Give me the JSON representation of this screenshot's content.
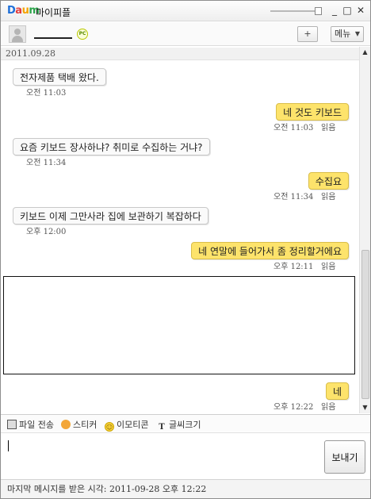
{
  "window": {
    "logo_text": "Daum",
    "title": "마이피플",
    "minimize_glyph": "_",
    "maximize_glyph": "□",
    "close_glyph": "✕"
  },
  "profile": {
    "status_badge": "PC",
    "add_user_glyph": "+",
    "menu_label": "메뉴",
    "menu_caret": "▼"
  },
  "chat": {
    "date": "2011.09.28",
    "messages": [
      {
        "text": "전자제품 택배 왔다.",
        "time": "오전 11:03",
        "read": ""
      },
      {
        "text": "네 것도 키보드",
        "time": "오전 11:03",
        "read": "읽음"
      },
      {
        "text": "요즘 키보드 장사하냐? 취미로 수집하는 거냐?",
        "time": "오전 11:34",
        "read": ""
      },
      {
        "text": "수집요",
        "time": "오전 11:34",
        "read": "읽음"
      },
      {
        "text": "키보드 이제 그만사라 집에 보관하기 복잡하다",
        "time": "오후 12:00",
        "read": ""
      },
      {
        "text": "네 연말에 들어가서 좀 정리할거에요",
        "time": "오후 12:11",
        "read": "읽음"
      },
      {
        "text": "네",
        "time": "오후 12:22",
        "read": "읽음"
      }
    ]
  },
  "scrollbar": {
    "up": "▲",
    "down": "▼"
  },
  "toolbar": {
    "file_transfer": "파일 전송",
    "sticker": "스티커",
    "emoticon": "이모티콘",
    "font_size": "글씨크기"
  },
  "input": {
    "value": "",
    "send_label": "보내기"
  },
  "status": {
    "last_message": "마지막 메시지를 받은 시각: 2011-09-28 오후 12:22"
  }
}
